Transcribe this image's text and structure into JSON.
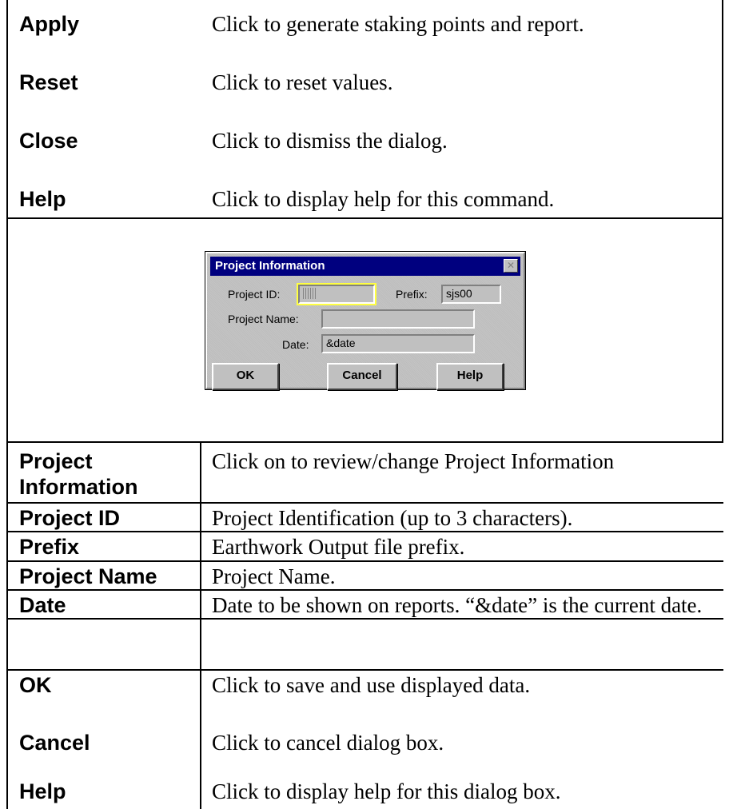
{
  "rows_top": [
    {
      "term": "Apply",
      "desc": "Click to generate staking points and report."
    },
    {
      "term": "Reset",
      "desc": "Click to reset values."
    },
    {
      "term": "Close",
      "desc": "Click to dismiss the dialog."
    },
    {
      "term": "Help",
      "desc": "Click to display help for this command."
    }
  ],
  "dialog": {
    "title": "Project Information",
    "close_glyph": "✕",
    "project_id_label": "Project ID:",
    "project_id_value": "",
    "prefix_label": "Prefix:",
    "prefix_value": "sjs00",
    "project_name_label": "Project Name:",
    "project_name_value": "",
    "date_label": "Date:",
    "date_value": "&date",
    "ok_label": "OK",
    "cancel_label": "Cancel",
    "help_label": "Help"
  },
  "rows_bottom": [
    {
      "term": "Project Information",
      "term_line1": "Project",
      "term_line2": "Information",
      "desc": "Click on to review/change Project Information"
    },
    {
      "term": "Project ID",
      "desc": "Project Identification (up to 3 characters)."
    },
    {
      "term": "Prefix",
      "desc": "Earthwork Output file prefix."
    },
    {
      "term": "Project Name",
      "desc": "Project Name."
    },
    {
      "term": "Date",
      "desc": "Date to be shown on reports. “&date” is the current date."
    },
    {
      "term": "OK",
      "desc": "Click to save and use displayed data."
    },
    {
      "term": "Cancel",
      "desc": "Click to cancel dialog box."
    },
    {
      "term": "Help",
      "desc": "Click to display help for this dialog box."
    }
  ]
}
